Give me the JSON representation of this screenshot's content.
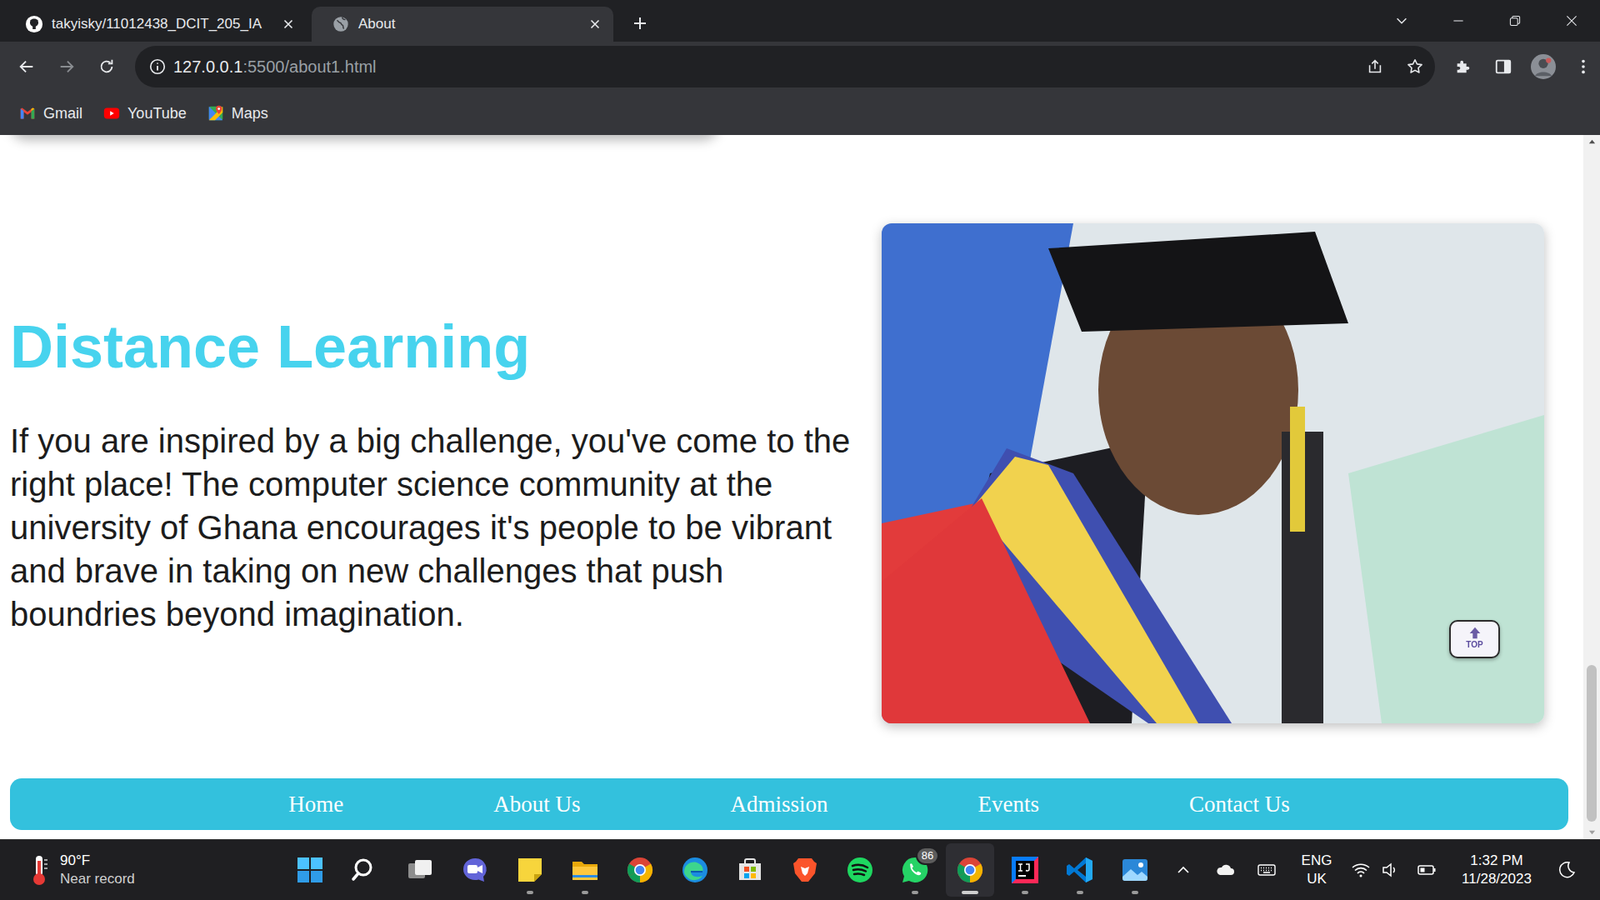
{
  "tabs": [
    {
      "label": "takyisky/11012438_DCIT_205_IA",
      "selected": false,
      "kind": "github"
    },
    {
      "label": "About",
      "selected": true,
      "kind": "globe"
    }
  ],
  "address": {
    "host": "127.0.0.1",
    "path": ":5500/about1.html"
  },
  "bookmarks": [
    {
      "label": "Gmail",
      "kind": "gmail"
    },
    {
      "label": "YouTube",
      "kind": "youtube"
    },
    {
      "label": "Maps",
      "kind": "maps"
    }
  ],
  "page": {
    "heading": "Distance Learning",
    "paragraph": "If you are inspired by a big challenge, you've come to the right place! The computer science community at the university of Ghana encourages it's people to be vibrant and brave in taking on new challenges that push boundries beyond imagination.",
    "top_button": "TOP",
    "nav": [
      "Home",
      "About Us",
      "Admission",
      "Events",
      "Contact Us"
    ]
  },
  "taskbar": {
    "weather": {
      "temp": "90°F",
      "note": "Near record"
    },
    "apps": [
      {
        "kind": "start",
        "running": false,
        "active": false
      },
      {
        "kind": "search",
        "running": false,
        "active": false
      },
      {
        "kind": "taskview",
        "running": false,
        "active": false
      },
      {
        "kind": "chat",
        "running": false,
        "active": false
      },
      {
        "kind": "sticky",
        "running": true,
        "active": false
      },
      {
        "kind": "explorer",
        "running": true,
        "active": false
      },
      {
        "kind": "chrome",
        "running": false,
        "active": false
      },
      {
        "kind": "edge",
        "running": false,
        "active": false
      },
      {
        "kind": "store",
        "running": false,
        "active": false
      },
      {
        "kind": "brave",
        "running": false,
        "active": false
      },
      {
        "kind": "spotify",
        "running": false,
        "active": false
      },
      {
        "kind": "whatsapp",
        "running": true,
        "active": false,
        "badge": "86"
      },
      {
        "kind": "chrome",
        "running": true,
        "active": true
      },
      {
        "kind": "intellij",
        "running": true,
        "active": false
      },
      {
        "kind": "vscode",
        "running": true,
        "active": false
      },
      {
        "kind": "photos",
        "running": true,
        "active": false
      }
    ],
    "tray": {
      "lang": "ENG",
      "region": "UK"
    },
    "clock": {
      "time": "1:32 PM",
      "date": "11/28/2023"
    }
  }
}
